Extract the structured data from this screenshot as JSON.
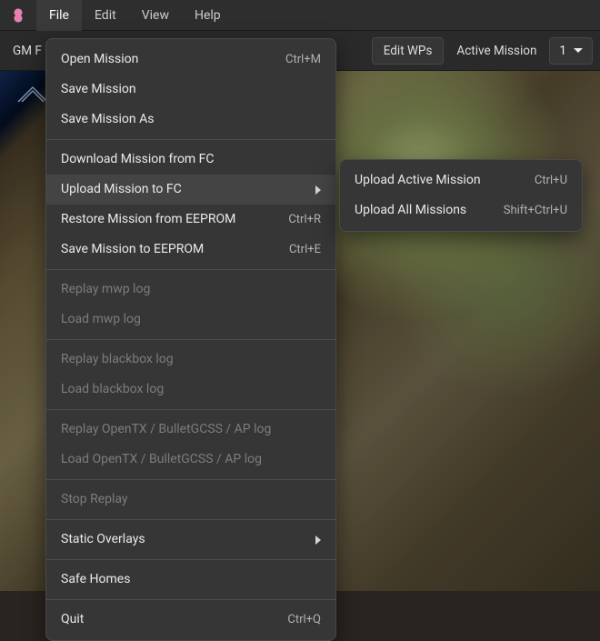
{
  "menubar": {
    "items": [
      "File",
      "Edit",
      "View",
      "Help"
    ]
  },
  "toolbar": {
    "gm_prefix": "GM F",
    "edit_wps": "Edit WPs",
    "active_mission_label": "Active Mission",
    "active_mission_value": "1"
  },
  "file_menu": {
    "open_mission": {
      "label": "Open Mission",
      "shortcut": "Ctrl+M"
    },
    "save_mission": {
      "label": "Save Mission"
    },
    "save_mission_as": {
      "label": "Save Mission As"
    },
    "download_fc": {
      "label": "Download Mission from FC"
    },
    "upload_fc": {
      "label": "Upload Mission to FC"
    },
    "restore_eeprom": {
      "label": "Restore Mission from EEPROM",
      "shortcut": "Ctrl+R"
    },
    "save_eeprom": {
      "label": "Save Mission to EEPROM",
      "shortcut": "Ctrl+E"
    },
    "replay_mwp": {
      "label": "Replay mwp log"
    },
    "load_mwp": {
      "label": "Load mwp log"
    },
    "replay_bb": {
      "label": "Replay blackbox log"
    },
    "load_bb": {
      "label": "Load blackbox log"
    },
    "replay_otx": {
      "label": "Replay OpenTX / BulletGCSS / AP log"
    },
    "load_otx": {
      "label": "Load OpenTX / BulletGCSS / AP log"
    },
    "stop_replay": {
      "label": "Stop Replay"
    },
    "static_overlays": {
      "label": "Static Overlays"
    },
    "safe_homes": {
      "label": "Safe Homes"
    },
    "quit": {
      "label": "Quit",
      "shortcut": "Ctrl+Q"
    }
  },
  "upload_submenu": {
    "active": {
      "label": "Upload Active Mission",
      "shortcut": "Ctrl+U"
    },
    "all": {
      "label": "Upload All Missions",
      "shortcut": "Shift+Ctrl+U"
    }
  }
}
